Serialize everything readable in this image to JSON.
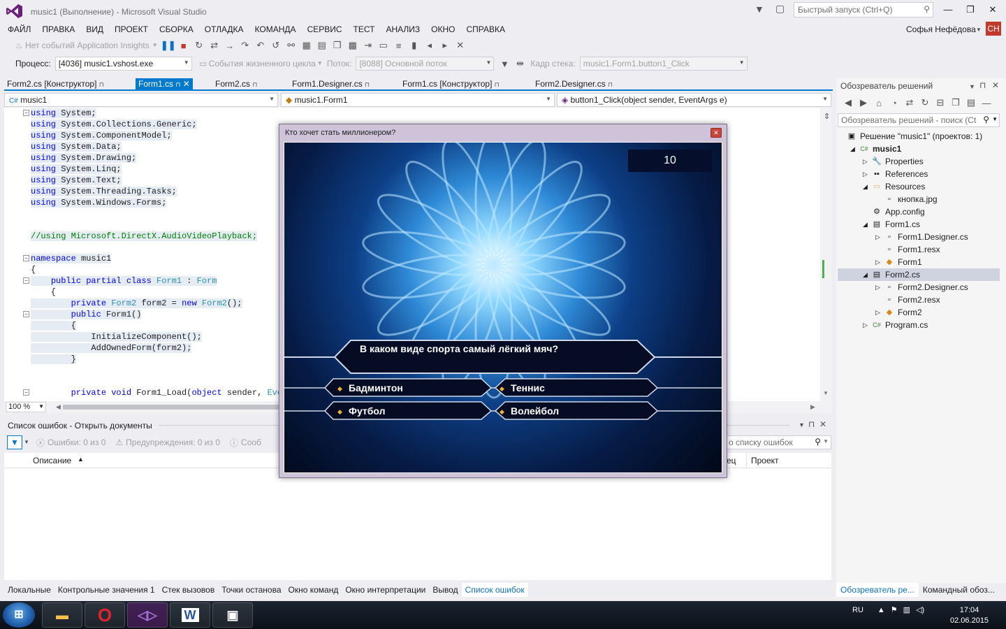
{
  "window": {
    "title": "music1 (Выполнение) - Microsoft Visual Studio",
    "quick_launch": "Быстрый запуск (Ctrl+Q)",
    "user": "Софья Нефёдова",
    "avatar": "СН"
  },
  "menu": [
    "ФАЙЛ",
    "ПРАВКА",
    "ВИД",
    "ПРОЕКТ",
    "СБОРКА",
    "ОТЛАДКА",
    "КОМАНДА",
    "СЕРВИС",
    "ТЕСТ",
    "АНАЛИЗ",
    "ОКНО",
    "СПРАВКА"
  ],
  "toolbar": {
    "insights": "Нет событий Application Insights",
    "process_label": "Процесс:",
    "process_value": "[4036] music1.vshost.exe",
    "lifecycle": "События жизненного цикла",
    "thread_label": "Поток:",
    "thread_value": "[8088] Основной поток",
    "stack_label": "Кадр стека:",
    "stack_value": "music1.Form1.button1_Click"
  },
  "doc_tabs": [
    "Form2.cs [Конструктор]",
    "Form1.cs",
    "Form2.cs",
    "Form1.Designer.cs",
    "Form1.cs [Конструктор]",
    "Form2.Designer.cs"
  ],
  "nav": {
    "project": "music1",
    "class": "music1.Form1",
    "member": "button1_Click(object sender, EventArgs e)"
  },
  "code_lines": [
    [
      [
        "kw",
        "using"
      ],
      [
        "",
        "System;"
      ]
    ],
    [
      [
        "kw",
        "using"
      ],
      [
        "",
        "System.Collections.Generic;"
      ]
    ],
    [
      [
        "kw",
        "using"
      ],
      [
        "",
        "System.ComponentModel;"
      ]
    ],
    [
      [
        "kw",
        "using"
      ],
      [
        "",
        "System.Data;"
      ]
    ],
    [
      [
        "kw",
        "using"
      ],
      [
        "",
        "System.Drawing;"
      ]
    ],
    [
      [
        "kw",
        "using"
      ],
      [
        "",
        "System.Linq;"
      ]
    ],
    [
      [
        "kw",
        "using"
      ],
      [
        "",
        "System.Text;"
      ]
    ],
    [
      [
        "kw",
        "using"
      ],
      [
        "",
        "System.Threading.Tasks;"
      ]
    ],
    [
      [
        "kw",
        "using"
      ],
      [
        "",
        "System.Windows.Forms;"
      ]
    ],
    [],
    [],
    [
      [
        "cm",
        "//using Microsoft.DirectX.AudioVideoPlayback;"
      ]
    ],
    [],
    [
      [
        "kw",
        "namespace"
      ],
      [
        "",
        " music1"
      ]
    ],
    [
      [
        "",
        "{"
      ]
    ],
    [
      [
        "",
        "    "
      ],
      [
        "kw",
        "public partial class"
      ],
      [
        "",
        " "
      ],
      [
        "ty",
        "Form1"
      ],
      [
        "",
        " : "
      ],
      [
        "ty",
        "Form"
      ]
    ],
    [
      [
        "",
        "    {"
      ]
    ],
    [
      [
        "",
        "        "
      ],
      [
        "kw",
        "private"
      ],
      [
        "",
        " "
      ],
      [
        "ty",
        "Form2"
      ],
      [
        "",
        " form2 = "
      ],
      [
        "kw",
        "new"
      ],
      [
        "",
        " "
      ],
      [
        "ty",
        "Form2"
      ],
      [
        "",
        "();"
      ]
    ],
    [
      [
        "",
        "        "
      ],
      [
        "kw",
        "public"
      ],
      [
        "",
        " Form1()"
      ]
    ],
    [
      [
        "",
        "        {"
      ]
    ],
    [
      [
        "",
        "            InitializeComponent();"
      ]
    ],
    [
      [
        "",
        "            AddOwnedForm(form2);"
      ]
    ],
    [
      [
        "",
        "        }"
      ]
    ],
    [],
    [],
    [
      [
        "",
        "        "
      ],
      [
        "kw",
        "private void"
      ],
      [
        "",
        " Form1_Load("
      ],
      [
        "kw",
        "object"
      ],
      [
        "",
        " sender, "
      ],
      [
        "ty",
        "Even"
      ]
    ]
  ],
  "zoom": "100 %",
  "error_list": {
    "title": "Список ошибок - Открыть документы",
    "errors": "Ошибки: 0 из 0",
    "warnings": "Предупреждения: 0 из 0",
    "messages": "Сооб",
    "search": "о списку ошибок",
    "col_desc": "Описание",
    "col_file": "ец",
    "col_project": "Проект"
  },
  "bottom_tabs": [
    "Локальные",
    "Контрольные значения 1",
    "Стек вызовов",
    "Точки останова",
    "Окно команд",
    "Окно интерпретации",
    "Вывод",
    "Список ошибок"
  ],
  "solution": {
    "title": "Обозреватель решений",
    "search": "Обозреватель решений - поиск (Ct",
    "items": [
      {
        "label": "Решение \"music1\" (проектов: 1)",
        "depth": 0,
        "icon": "solution-icon",
        "glyph": "▣",
        "arrow": ""
      },
      {
        "label": "music1",
        "depth": 1,
        "icon": "csharp-project-icon",
        "glyph": "C#",
        "arrow": "◢",
        "bold": true
      },
      {
        "label": "Properties",
        "depth": 2,
        "icon": "wrench-icon",
        "glyph": "🔧",
        "arrow": "▷"
      },
      {
        "label": "References",
        "depth": 2,
        "icon": "references-icon",
        "glyph": "▪▪",
        "arrow": "▷"
      },
      {
        "label": "Resources",
        "depth": 2,
        "icon": "folder-icon",
        "glyph": "▭",
        "arrow": "◢"
      },
      {
        "label": "кнопка.jpg",
        "depth": 3,
        "icon": "image-file-icon",
        "glyph": "▫",
        "arrow": ""
      },
      {
        "label": "App.config",
        "depth": 2,
        "icon": "config-file-icon",
        "glyph": "⚙",
        "arrow": ""
      },
      {
        "label": "Form1.cs",
        "depth": 2,
        "icon": "form-icon",
        "glyph": "▤",
        "arrow": "◢"
      },
      {
        "label": "Form1.Designer.cs",
        "depth": 3,
        "icon": "cs-file-icon",
        "glyph": "▫",
        "arrow": "▷"
      },
      {
        "label": "Form1.resx",
        "depth": 3,
        "icon": "resx-file-icon",
        "glyph": "▫",
        "arrow": ""
      },
      {
        "label": "Form1",
        "depth": 3,
        "icon": "class-icon",
        "glyph": "◆",
        "arrow": "▷"
      },
      {
        "label": "Form2.cs",
        "depth": 2,
        "icon": "form-icon",
        "glyph": "▤",
        "arrow": "◢",
        "selected": true
      },
      {
        "label": "Form2.Designer.cs",
        "depth": 3,
        "icon": "cs-file-icon",
        "glyph": "▫",
        "arrow": "▷"
      },
      {
        "label": "Form2.resx",
        "depth": 3,
        "icon": "resx-file-icon",
        "glyph": "▫",
        "arrow": ""
      },
      {
        "label": "Form2",
        "depth": 3,
        "icon": "class-icon",
        "glyph": "◆",
        "arrow": "▷"
      },
      {
        "label": "Program.cs",
        "depth": 2,
        "icon": "csharp-file-icon",
        "glyph": "C#",
        "arrow": "▷"
      }
    ],
    "tab_active": "Обозреватель ре...",
    "tab_other": "Командный обоз..."
  },
  "game": {
    "title": "Кто хочет стать миллионером?",
    "counter": "10",
    "question": "В каком виде спорта самый лёгкий мяч?",
    "answers": [
      "Бадминтон",
      "Теннис",
      "Футбол",
      "Волейбол"
    ]
  },
  "taskbar": {
    "lang": "RU",
    "time": "17:04",
    "date": "02.06.2015"
  },
  "colors": {
    "accent": "#007acc",
    "keyword": "#0000ff",
    "type": "#2b91af",
    "comment": "#008000"
  }
}
